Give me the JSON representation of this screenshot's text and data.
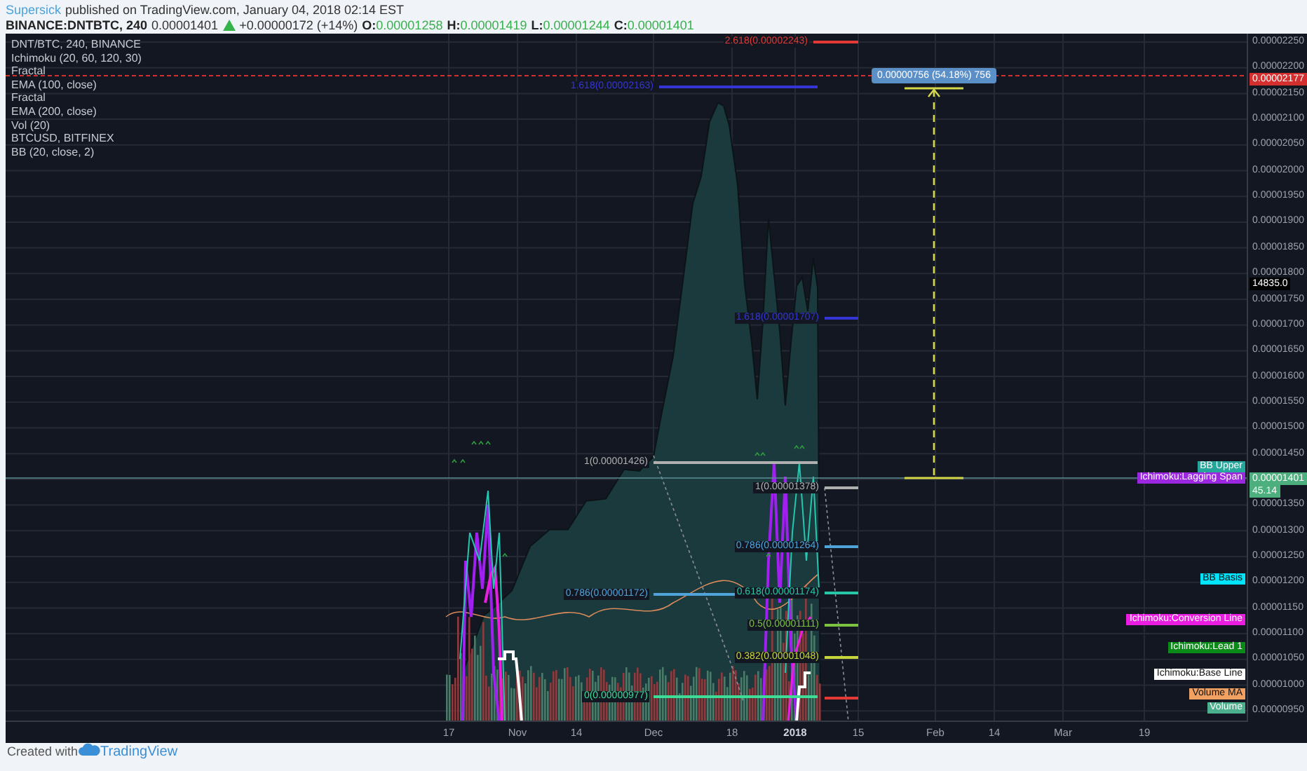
{
  "header": {
    "author": "Supersick",
    "byline": "published on TradingView.com, January 04, 2018 02:14 EST"
  },
  "quote": {
    "symbol": "BINANCE:DNTBTC, 240",
    "last": "0.00001401",
    "change": "+0.00000172 (+14%)",
    "ohlc": [
      {
        "key": "O:",
        "value": "0.00001258"
      },
      {
        "key": "H:",
        "value": "0.00001419"
      },
      {
        "key": "L:",
        "value": "0.00001244"
      },
      {
        "key": "C:",
        "value": "0.00001401"
      }
    ]
  },
  "legend": [
    "DNT/BTC, 240, BINANCE",
    "Ichimoku (20, 60, 120, 30)",
    "Fractal",
    "EMA (100, close)",
    "Fractal",
    "EMA (200, close)",
    "Vol (20)",
    "BTCUSD, BITFINEX",
    "BB (20, close, 2)"
  ],
  "price_axis": {
    "ticks": [
      "0.00002250",
      "0.00002200",
      "0.00002150",
      "0.00002100",
      "0.00002050",
      "0.00002000",
      "0.00001950",
      "0.00001900",
      "0.00001850",
      "0.00001800",
      "0.00001750",
      "0.00001700",
      "0.00001650",
      "0.00001600",
      "0.00001550",
      "0.00001500",
      "0.00001450",
      "0.00001350",
      "0.00001300",
      "0.00001250",
      "0.00001200",
      "0.00001150",
      "0.00001100",
      "0.00001050",
      "0.00001000",
      "0.00000950"
    ],
    "badges": [
      {
        "label": "0.00002177",
        "color": "#d32f2f"
      },
      {
        "label": "14835.0",
        "color": "#000000"
      },
      {
        "label": "0.00001401",
        "color": "#4caf7d"
      },
      {
        "label": "45.14",
        "color": "#4caf7d"
      }
    ]
  },
  "time_axis": {
    "ticks": [
      "17",
      "Nov",
      "14",
      "Dec",
      "18",
      "2018",
      "15",
      "Feb",
      "14",
      "Mar",
      "19"
    ]
  },
  "fib_levels": [
    {
      "label": "2.618(0.00002243)",
      "color": "#e53935"
    },
    {
      "label": "1.618(0.00002163)",
      "color": "#3535d6"
    },
    {
      "label": "1.618(0.00001707)",
      "color": "#3535d6"
    },
    {
      "label": "1(0.00001426)",
      "color": "#b0b0b0"
    },
    {
      "label": "1(0.00001378)",
      "color": "#b0b0b0"
    },
    {
      "label": "0.786(0.00001264)",
      "color": "#4fa3d9"
    },
    {
      "label": "0.786(0.00001172)",
      "color": "#4fa3d9"
    },
    {
      "label": "0.618(0.00001174)",
      "color": "#26c6a6"
    },
    {
      "label": "0.5(0.00001111)",
      "color": "#7cc342"
    },
    {
      "label": "0.382(0.00001048)",
      "color": "#c6d63a"
    },
    {
      "label": "0(0.00000977)",
      "color": "#3ddc97"
    },
    {
      "color": "#e53935"
    }
  ],
  "series_labels": [
    {
      "label": "BB Upper",
      "color": "#26a69a"
    },
    {
      "label": "Ichimoku:Lagging Span",
      "color": "#9c27e0"
    },
    {
      "label": "BB Basis",
      "color": "#00e5ff"
    },
    {
      "label": "Ichimoku:Conversion Line",
      "color": "#e91ee0"
    },
    {
      "label": "Ichimoku:Lead 1",
      "color": "#0b8a1a"
    },
    {
      "label": "Ichimoku:Base Line",
      "color": "#ffffff"
    },
    {
      "label": "Volume MA",
      "color": "#f0a060"
    },
    {
      "label": "Volume",
      "color": "#4caf8d"
    }
  ],
  "measure": {
    "label": "0.00000756 (54.18%) 756"
  },
  "footer": {
    "text": "Created with",
    "brand": "TradingView"
  }
}
